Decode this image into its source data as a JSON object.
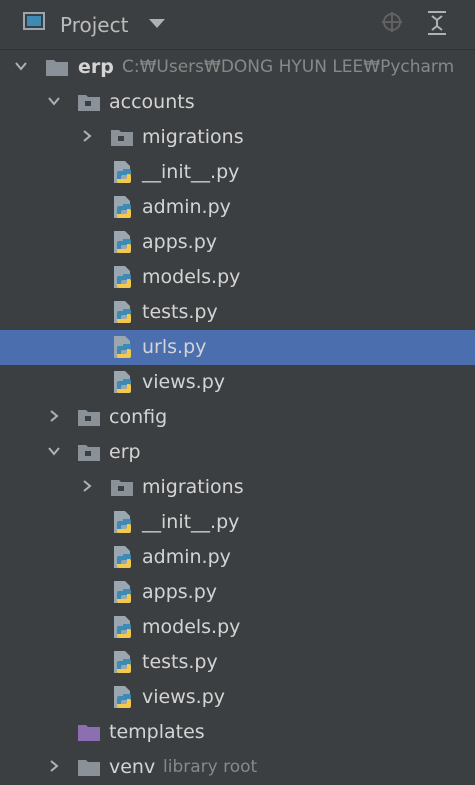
{
  "header": {
    "title": "Project"
  },
  "tree": {
    "root": {
      "label": "erp",
      "path": "C:₩Users₩DONG HYUN LEE₩Pycharm"
    },
    "accounts": {
      "label": "accounts"
    },
    "accounts_migrations": {
      "label": "migrations"
    },
    "accounts_files": [
      "__init__.py",
      "admin.py",
      "apps.py",
      "models.py",
      "tests.py",
      "urls.py",
      "views.py"
    ],
    "config": {
      "label": "config"
    },
    "erp": {
      "label": "erp"
    },
    "erp_migrations": {
      "label": "migrations"
    },
    "erp_files": [
      "__init__.py",
      "admin.py",
      "apps.py",
      "models.py",
      "tests.py",
      "views.py"
    ],
    "templates": {
      "label": "templates"
    },
    "venv": {
      "label": "venv",
      "note": "library root"
    }
  },
  "colors": {
    "background": "#3c3f41",
    "selection": "#4b6eaf",
    "folder": "#8a9199",
    "template_folder": "#8b6fb0",
    "python_blue": "#3d8ab5",
    "python_yellow": "#f2c94c"
  }
}
